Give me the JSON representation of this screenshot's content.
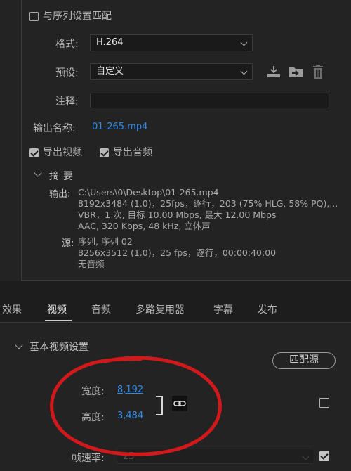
{
  "match_sequence": {
    "label": "与序列设置匹配",
    "checked": false
  },
  "format": {
    "label": "格式:",
    "value": "H.264"
  },
  "preset": {
    "label": "预设:",
    "value": "自定义"
  },
  "comment": {
    "label": "注释:",
    "value": ""
  },
  "output_name": {
    "label": "输出名称:",
    "value": "01-265.mp4"
  },
  "export_video": {
    "label": "导出视频",
    "checked": true
  },
  "export_audio": {
    "label": "导出音频",
    "checked": true
  },
  "summary": {
    "title": "摘要",
    "output_label": "输出:",
    "output_lines": [
      "C:\\Users\\0\\Desktop\\01-265.mp4",
      "8192x3484 (1.0)，25fps，逐行，203 (75% HLG, 58% PQ),...",
      "VBR，1 次, 目标 10.00 Mbps, 最大 12.00 Mbps",
      "AAC, 320 Kbps, 48 kHz, 立体声"
    ],
    "source_label": "源:",
    "source_lines": [
      "序列, 序列 02",
      "8256x3512 (1.0)，25 fps，逐行，00:00:40:00",
      "无音频"
    ]
  },
  "tabs": [
    {
      "label": "效果"
    },
    {
      "label": "视频",
      "active": true
    },
    {
      "label": "音频"
    },
    {
      "label": "多路复用器"
    },
    {
      "label": "字幕"
    },
    {
      "label": "发布"
    }
  ],
  "basic_video": {
    "title": "基本视频设置",
    "match_source_button": "匹配源",
    "width_label": "宽度:",
    "width_value": "8,192",
    "height_label": "高度:",
    "height_value": "3,484",
    "frame_rate_label": "帧速率:",
    "frame_rate_value": "25"
  },
  "colors": {
    "accent_link": "#2d8ceb",
    "annotation_circle": "#d0191b",
    "background": "#232323"
  }
}
